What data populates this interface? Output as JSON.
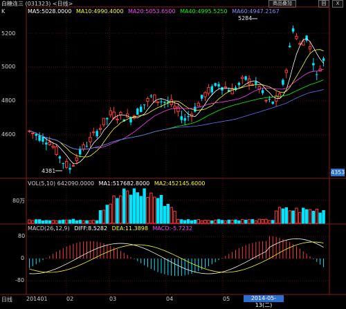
{
  "window": {
    "title": "白糖连三 (031323) <日线>",
    "btn_superimpose": "商品叠加",
    "btn_restore": "回",
    "btn_close": "X"
  },
  "price_panel": {
    "k_label": "K",
    "ma5": "MA5:5028.0000",
    "ma10": "MA10:4990.4000",
    "ma20": "MA20:5053.6500",
    "ma40": "MA40:4995.5250",
    "ma60": "MA60:4947.2167",
    "y_ticks": [
      "5200",
      "5000",
      "4800",
      "4600"
    ],
    "high_label": "5284",
    "low_label": "4381",
    "last_price": "4353"
  },
  "volume_panel": {
    "header": "VOL(5,10) 642090.0000",
    "ma1": "MA1:517682.8000",
    "ma2": "MA2:452145.6000",
    "y_tick": "80万"
  },
  "macd_panel": {
    "header": "MACD(26,12,9)",
    "diff": "DIFF:8.5282",
    "dea": "DEA:11.3898",
    "macd": "MACD:-5.7232",
    "y_ticks": [
      "80",
      "0",
      "-80"
    ]
  },
  "x_axis": {
    "label": "日线",
    "ticks": [
      "201401",
      "02",
      "03",
      "04",
      "05"
    ],
    "cursor_date": "2014-05-13(二)"
  },
  "colors": {
    "up": "#ff3b3b",
    "down": "#00e5ff",
    "ma5": "#ffffff",
    "ma10": "#ffff00",
    "ma20": "#ff40ff",
    "ma40": "#00ff00",
    "ma60": "#6c6cff",
    "diff": "#ffffff",
    "dea": "#ffff00"
  }
}
